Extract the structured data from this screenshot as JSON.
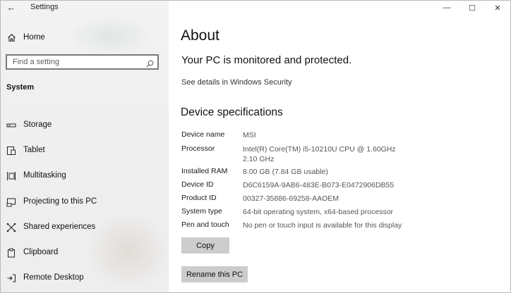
{
  "window": {
    "app_title": "Settings",
    "back_glyph": "←",
    "controls": {
      "minimize": "—",
      "maximize": "☐",
      "close": "✕"
    }
  },
  "sidebar": {
    "home_label": "Home",
    "search_placeholder": "Find a setting",
    "section_label": "System",
    "items": [
      {
        "label": "Storage",
        "icon": "storage-icon"
      },
      {
        "label": "Tablet",
        "icon": "tablet-icon"
      },
      {
        "label": "Multitasking",
        "icon": "multitasking-icon"
      },
      {
        "label": "Projecting to this PC",
        "icon": "projecting-icon"
      },
      {
        "label": "Shared experiences",
        "icon": "shared-experiences-icon"
      },
      {
        "label": "Clipboard",
        "icon": "clipboard-icon"
      },
      {
        "label": "Remote Desktop",
        "icon": "remote-desktop-icon"
      }
    ]
  },
  "main": {
    "title": "About",
    "protection_status": "Your PC is monitored and protected.",
    "security_link": "See details in Windows Security",
    "spec_heading": "Device specifications",
    "specs": [
      {
        "key": "Device name",
        "value": "MSI"
      },
      {
        "key": "Processor",
        "value": "Intel(R) Core(TM) i5-10210U CPU @ 1.60GHz   2.10 GHz"
      },
      {
        "key": "Installed RAM",
        "value": "8.00 GB (7.84 GB usable)"
      },
      {
        "key": "Device ID",
        "value": "D6C6159A-9AB6-483E-B073-E0472906DB55"
      },
      {
        "key": "Product ID",
        "value": "00327-35886-69258-AAOEM"
      },
      {
        "key": "System type",
        "value": "64-bit operating system, x64-based processor"
      },
      {
        "key": "Pen and touch",
        "value": "No pen or touch input is available for this display"
      }
    ],
    "copy_button": "Copy",
    "rename_button": "Rename this PC"
  }
}
